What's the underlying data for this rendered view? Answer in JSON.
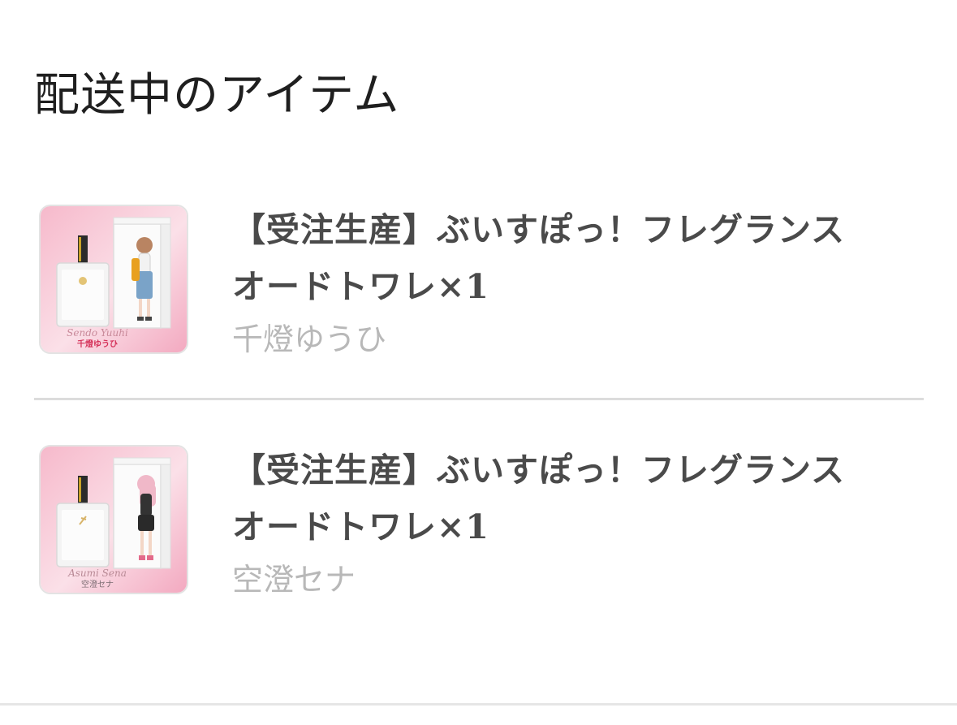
{
  "section": {
    "title": "配送中のアイテム"
  },
  "items": [
    {
      "name": "【受注生産】ぶいすぽっ！フレグランス　オードトワレ",
      "quantity": "×1",
      "character": "千燈ゆうひ",
      "thumbnail_signature": "Sendo Yuuhi",
      "thumbnail_label": "千燈ゆうひ",
      "hair_color": "#b98462",
      "accent": "#e8a020"
    },
    {
      "name": "【受注生産】ぶいすぽっ！フレグランス　オードトワレ",
      "quantity": "×1",
      "character": "空澄セナ",
      "thumbnail_signature": "Asumi Sena",
      "thumbnail_label": "空澄セナ",
      "hair_color": "#f0b8c8",
      "accent": "#333333"
    }
  ]
}
